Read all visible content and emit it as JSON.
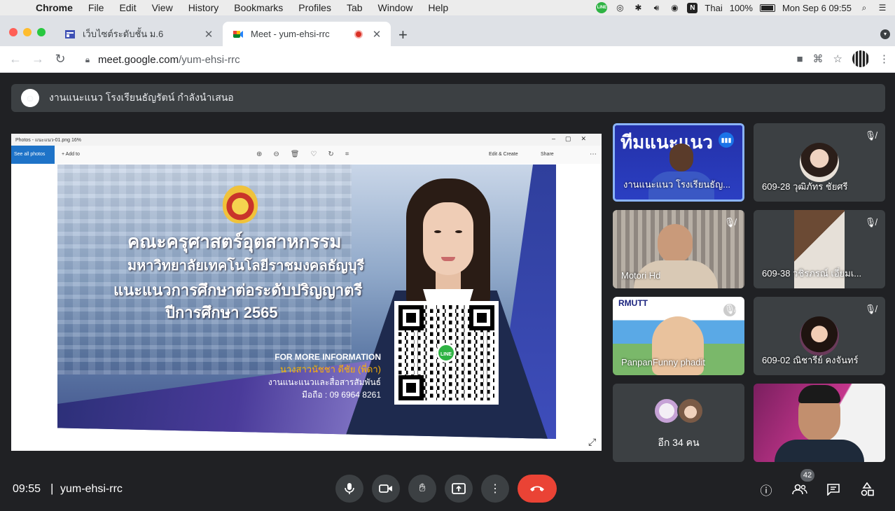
{
  "menubar": {
    "apple": "",
    "items": [
      "Chrome",
      "File",
      "Edit",
      "View",
      "History",
      "Bookmarks",
      "Profiles",
      "Tab",
      "Window",
      "Help"
    ],
    "input_lang": "Thai",
    "battery": "100%",
    "datetime": "Mon Sep 6  09:55"
  },
  "tabs": [
    {
      "title": "เว็บไซต์ระดับชั้น ม.6",
      "close": "✕"
    },
    {
      "title": "Meet - yum-ehsi-rrc",
      "close": "✕"
    }
  ],
  "newtab": "+",
  "url": {
    "host": "meet.google.com",
    "path": "/yum-ehsi-rrc"
  },
  "presenting_banner": "งานแนะแนว โรงเรียนธัญรัตน์ กำลังนำเสนอ",
  "photos_app": {
    "title": "Photos - แนะแนว-01.png  16%",
    "see_all": "See all photos",
    "add_to": "Add to",
    "edit_create": "Edit & Create",
    "share": "Share"
  },
  "slide": {
    "line1": "คณะครุศาสตร์อุตสาหกรรม",
    "line2": "มหาวิทยาลัยเทคโนโลยีราชมงคลธัญบุรี",
    "line3": "แนะแนวการศึกษาต่อระดับปริญญาตรี",
    "line4": "ปีการศึกษา 2565",
    "info_heading": "FOR MORE INFORMATION",
    "info_name": "นางสาวนัชชา ดีชัย (พี่ดา)",
    "info_dept": "งานแนะแนวและสื่อสารสัมพันธ์",
    "info_phone": "มือถือ : 09 6964 8261",
    "qr_logo": "LINE"
  },
  "participants": [
    {
      "name": "งานแนะแนว โรงเรียนธัญ...",
      "banner": "ทีมแนะแนว"
    },
    {
      "name": "609-28 วุฒิภัทร ชัยศรี"
    },
    {
      "name": "Motori Hd"
    },
    {
      "name": "609-38 วชิรภรณ์ เอี่ยมเ..."
    },
    {
      "name": "PanpanFunny phadit",
      "banner": "RMUTT"
    },
    {
      "name": "609-02 ณิชารีย์ คงจันทร์"
    },
    {
      "name": "อีก 34 คน"
    },
    {
      "name": ""
    }
  ],
  "bottom": {
    "time": "09:55",
    "separator": "|",
    "meeting_code": "yum-ehsi-rrc",
    "people_count": "42"
  },
  "colors": {
    "accent": "#8ab4f8",
    "end_call": "#ea4335",
    "meet_bg": "#202124",
    "tile_bg": "#3c4043"
  }
}
